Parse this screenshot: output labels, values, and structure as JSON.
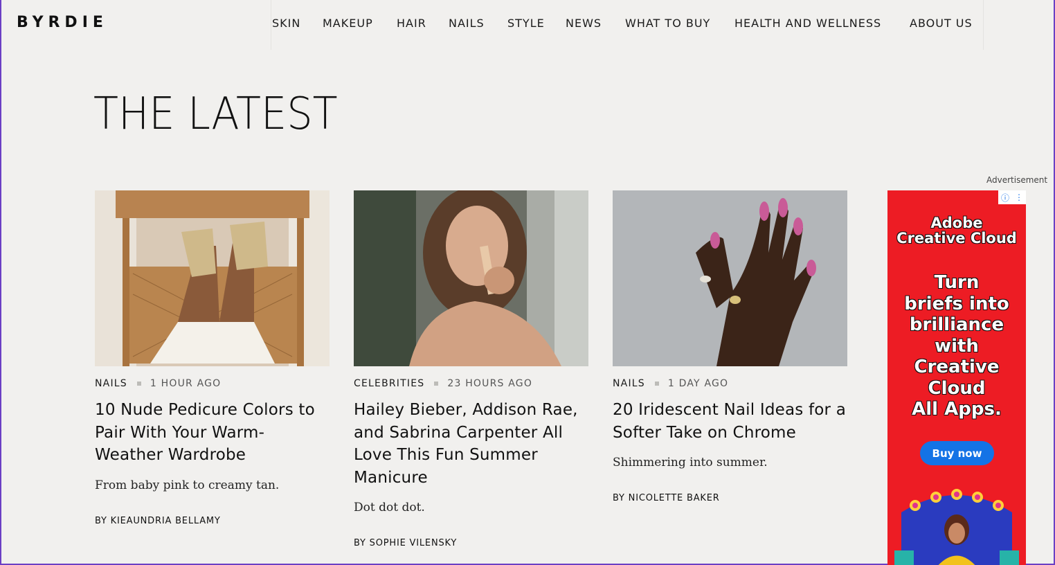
{
  "header": {
    "logo": "BYRDIE",
    "nav": [
      "SKIN",
      "MAKEUP",
      "HAIR",
      "NAILS",
      "STYLE",
      "NEWS",
      "WHAT TO BUY",
      "HEALTH AND WELLNESS",
      "ABOUT US"
    ]
  },
  "main": {
    "title": "THE LATEST",
    "articles": [
      {
        "category": "NAILS",
        "time": "1 HOUR AGO",
        "title": "10 Nude Pedicure Colors to Pair With Your Warm-Weather Wardrobe",
        "desc": "From baby pink to creamy tan.",
        "byline": "BY KIEAUNDRIA BELLAMY"
      },
      {
        "category": "CELEBRITIES",
        "time": "23 HOURS AGO",
        "title": "Hailey Bieber, Addison Rae, and Sabrina Carpenter All Love This Fun Summer Manicure",
        "desc": "Dot dot dot.",
        "byline": "BY SOPHIE VILENSKY"
      },
      {
        "category": "NAILS",
        "time": "1 DAY AGO",
        "title": "20 Iridescent Nail Ideas for a Softer Take on Chrome",
        "desc": "Shimmering into summer.",
        "byline": "BY NICOLETTE BAKER"
      }
    ]
  },
  "ad": {
    "label": "Advertisement",
    "brand_line1": "Adobe",
    "brand_line2": "Creative Cloud",
    "headline": [
      "Turn",
      "briefs into",
      "brilliance",
      "with",
      "Creative",
      "Cloud",
      "All Apps."
    ],
    "button": "Buy now",
    "color": "#ed1c24"
  }
}
